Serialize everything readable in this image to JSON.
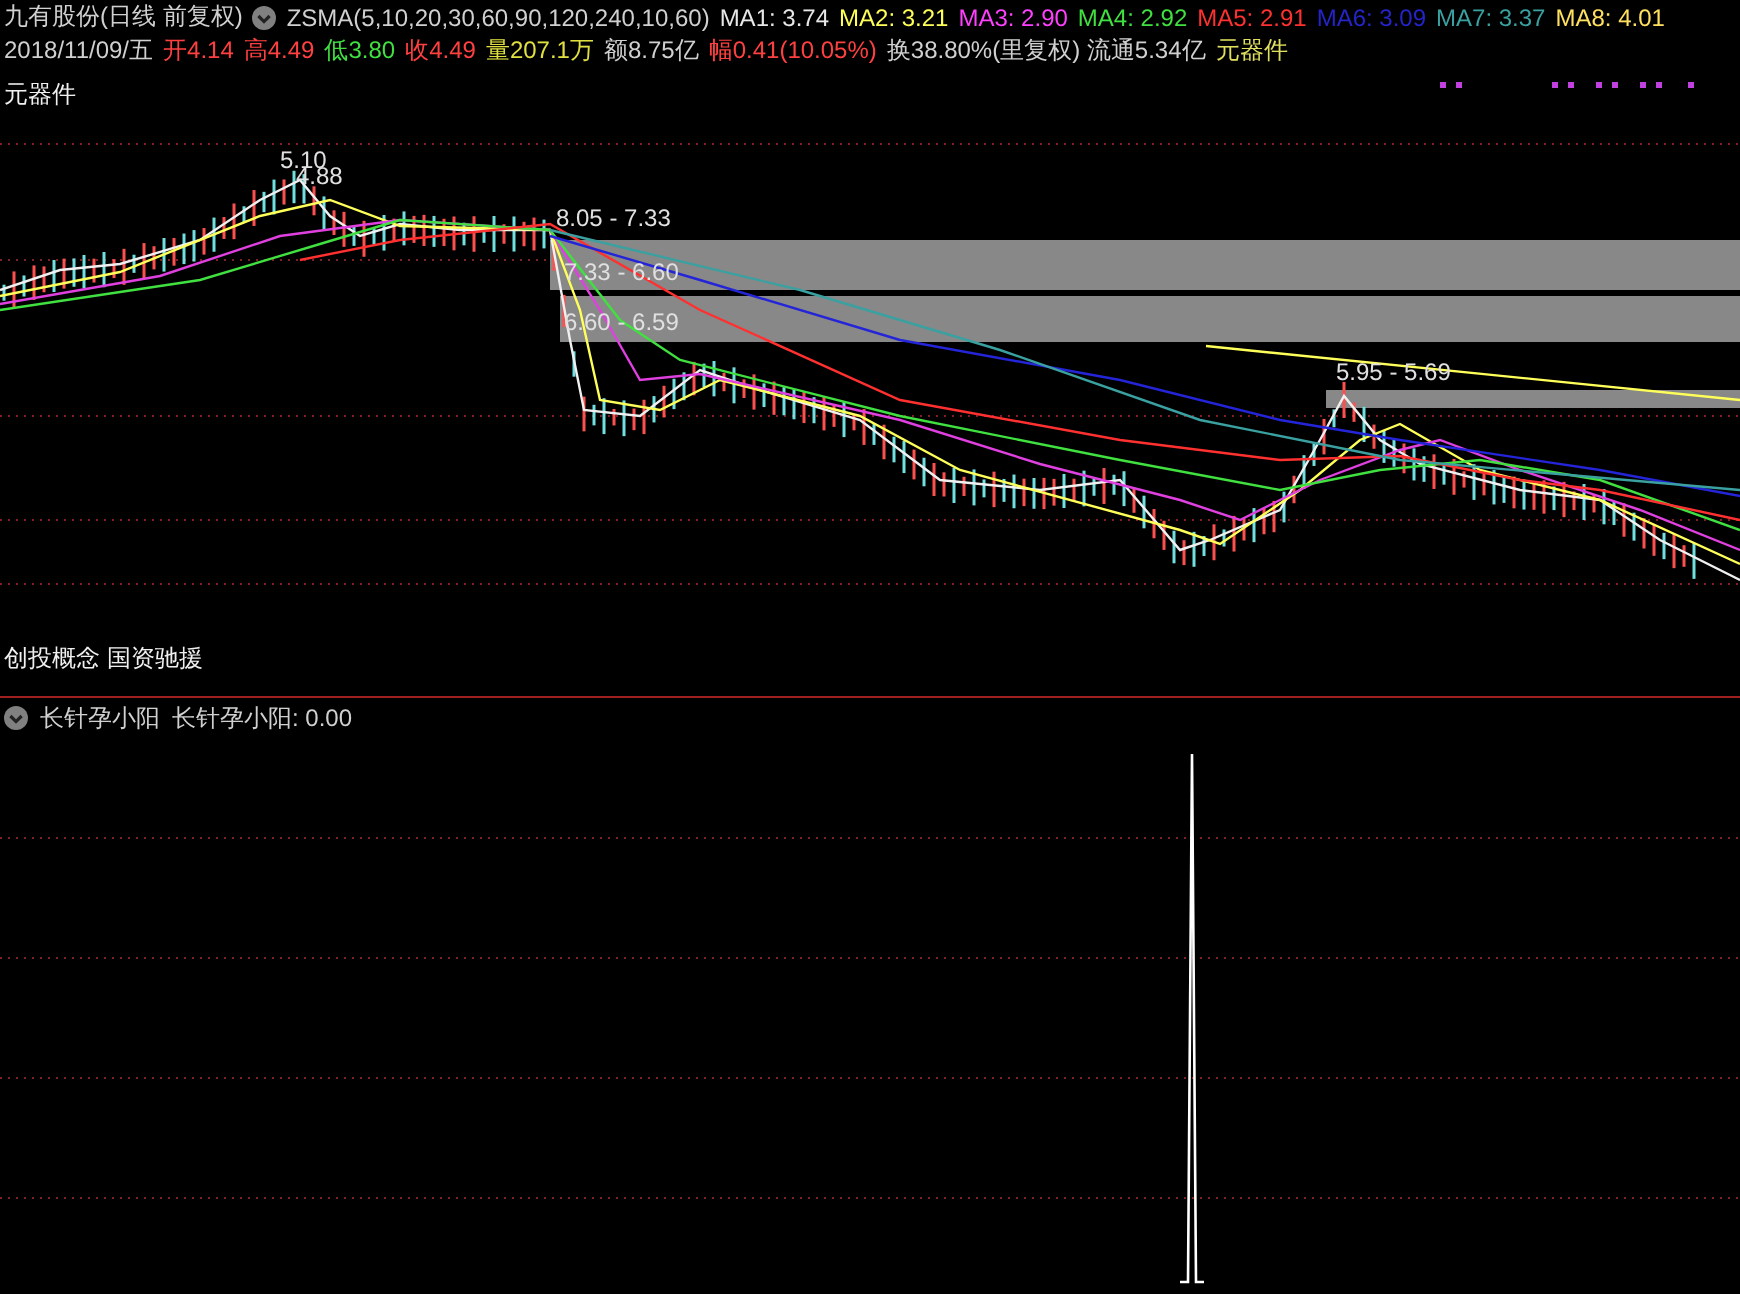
{
  "header": {
    "title": "九有股份(日线 前复权)",
    "indicator": "ZSMA(5,10,20,30,60,90,120,240,10,60)",
    "ma": [
      {
        "label": "MA1:",
        "value": "3.74",
        "color": "#e8e8e8"
      },
      {
        "label": "MA2:",
        "value": "3.21",
        "color": "#ffff5a"
      },
      {
        "label": "MA3:",
        "value": "2.90",
        "color": "#ff40ff"
      },
      {
        "label": "MA4:",
        "value": "2.92",
        "color": "#40e040"
      },
      {
        "label": "MA5:",
        "value": "2.91",
        "color": "#ff3030"
      },
      {
        "label": "MA6:",
        "value": "3.09",
        "color": "#2424c8"
      },
      {
        "label": "MA7:",
        "value": "3.37",
        "color": "#3aa0a0"
      },
      {
        "label": "MA8:",
        "value": "4.01",
        "color": "#ffe060"
      }
    ]
  },
  "quote": {
    "date": "2018/11/09/五",
    "fields": [
      {
        "label": "开",
        "value": "4.14",
        "color": "#ff4040"
      },
      {
        "label": "高",
        "value": "4.49",
        "color": "#ff4040"
      },
      {
        "label": "低",
        "value": "3.80",
        "color": "#40e040"
      },
      {
        "label": "收",
        "value": "4.49",
        "color": "#ff4040"
      },
      {
        "label": "量",
        "value": "207.1万",
        "color": "#e0e040"
      },
      {
        "label": "额",
        "value": "8.75亿",
        "color": "#d0d0d0"
      },
      {
        "label": "幅",
        "value": "0.41(10.05%)",
        "color": "#ff4040"
      }
    ],
    "turnover": "换38.80%(里复权) 流通5.34亿",
    "sector": "元器件"
  },
  "price_panel": {
    "sector_label": "元器件",
    "labels": [
      "5.10",
      "4.88",
      "8.05 - 7.33",
      "7.33 - 6.60",
      "6.60 - 6.59",
      "5.95 - 5.69"
    ]
  },
  "concepts": "创投概念 国资驰援",
  "indicator_panel": {
    "name": "长针孕小阳",
    "reading": "长针孕小阳: 0.00"
  }
}
